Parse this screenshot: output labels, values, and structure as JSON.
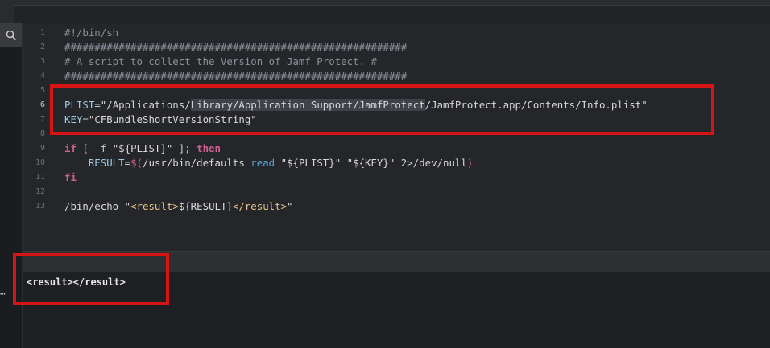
{
  "editor": {
    "line_numbers": [
      "1",
      "2",
      "3",
      "4",
      "5",
      "6",
      "7",
      "8",
      "9",
      "10",
      "11",
      "12",
      "13"
    ],
    "active_line": "6",
    "lines": {
      "l1": "#!/bin/sh",
      "l2": "#########################################################",
      "l3": "# A script to collect the Version of Jamf Protect. #",
      "l4": "#########################################################",
      "l6": {
        "var": "PLIST",
        "eq": "=",
        "q_open": "\"",
        "path_a": "/Applications/",
        "path_sel": "Library/Application Support/JamfProtect",
        "path_b": "/JamfProtect.app/Contents/Info.plist",
        "q_close": "\""
      },
      "l7": {
        "var": "KEY",
        "eq": "=",
        "str": "\"CFBundleShortVersionString\""
      },
      "l9": {
        "kw_if": "if",
        "cond_a": " [ -f ",
        "str": "\"${PLIST}\"",
        "cond_b": " ]; ",
        "kw_then": "then"
      },
      "l10": {
        "indent": "    ",
        "var": "RESULT",
        "eq": "=",
        "subst": "$(",
        "cmd": "/usr/bin/defaults ",
        "read": "read",
        "arg1": " \"${PLIST}\"",
        "arg2": " \"${KEY}\"",
        "redir": " 2>",
        "devnull": "/dev/null",
        "close": ")"
      },
      "l11": "fi",
      "l13": {
        "cmd": "/bin/echo ",
        "q_open": "\"",
        "tag_open": "<result>",
        "var": "${RESULT}",
        "tag_close": "</result>",
        "q_close": "\""
      }
    }
  },
  "output": {
    "text": "<result></result>"
  },
  "sidebar": {
    "search_icon": "search-icon",
    "more_glyph": "⋯"
  },
  "colors": {
    "highlight_box": "#d61414",
    "keyword": "#d0618f",
    "variable": "#9ccbe5"
  }
}
